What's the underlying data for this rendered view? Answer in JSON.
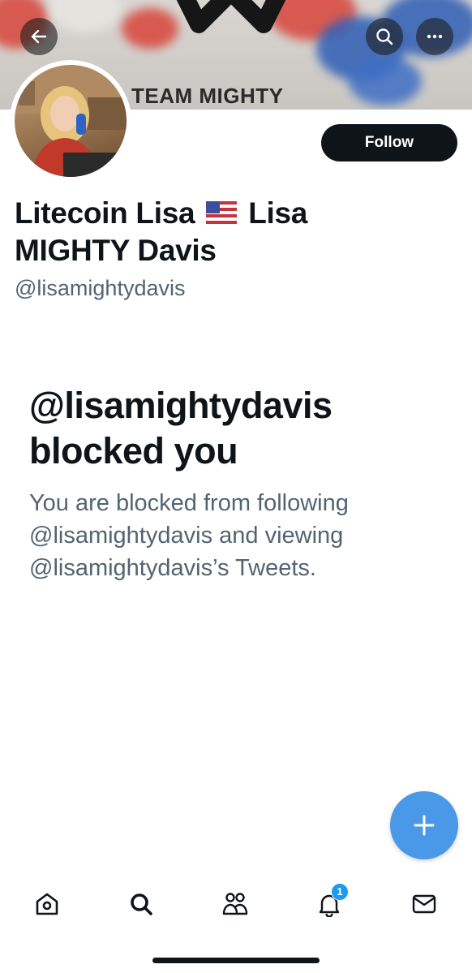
{
  "banner": {
    "text": "TEAM MIGHTY",
    "colors": {
      "red": "#d8453b",
      "blue": "#2f5fb5",
      "background": "#d6d3cf"
    }
  },
  "header": {
    "back_icon": "arrow-left-icon",
    "search_icon": "search-icon",
    "more_icon": "more-horizontal-icon"
  },
  "profile": {
    "name_part1": "Litecoin Lisa",
    "flag": "🇺🇸",
    "name_part2": "Lisa MIGHTY Davis",
    "handle": "@lisamightydavis",
    "follow_label": "Follow"
  },
  "blocked": {
    "title_line1": "@lisamightydavis",
    "title_line2": "blocked you",
    "description": "You are blocked from following @lisamightydavis and viewing @lisamightydavis’s Tweets."
  },
  "fab": {
    "icon": "plus-icon"
  },
  "tabbar": {
    "items": [
      {
        "icon": "home-icon"
      },
      {
        "icon": "search-icon"
      },
      {
        "icon": "communities-icon"
      },
      {
        "icon": "notifications-icon",
        "badge": "1"
      },
      {
        "icon": "messages-icon"
      }
    ]
  },
  "colors": {
    "accent": "#1d9bf0",
    "fab": "#4a99e9",
    "text": "#0f1419",
    "secondary": "#536471"
  }
}
